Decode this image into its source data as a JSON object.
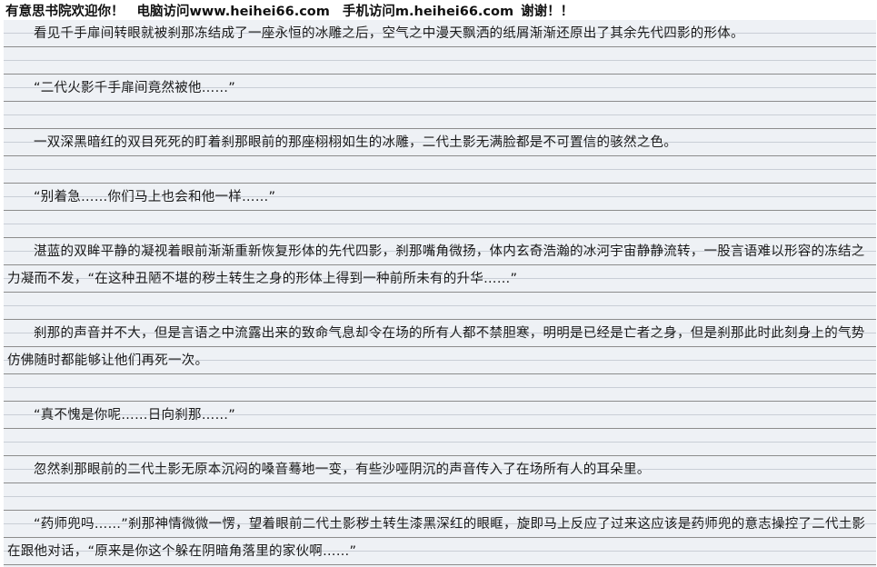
{
  "header": {
    "site_text": "有意思书院欢迎你！",
    "pc_text": "电脑访问www.heihei66.com",
    "mobile_text": "手机访问m.heihei66.com",
    "thanks_text": "谢谢！！"
  },
  "paragraphs": [
    "看见千手扉间转眼就被刹那冻结成了一座永恒的冰雕之后，空气之中漫天飘洒的纸屑渐渐还原出了其余先代四影的形体。",
    "“二代火影千手扉间竟然被他……”",
    "一双深黑暗红的双目死死的盯着刹那眼前的那座栩栩如生的冰雕，二代土影无满脸都是不可置信的骇然之色。",
    "“别着急……你们马上也会和他一样……”",
    "湛蓝的双眸平静的凝视着眼前渐渐重新恢复形体的先代四影，刹那嘴角微扬，体内玄奇浩瀚的冰河宇宙静静流转，一股言语难以形容的冻结之力凝而不发，“在这种丑陋不堪的秽土转生之身的形体上得到一种前所未有的升华……”",
    "刹那的声音并不大，但是言语之中流露出来的致命气息却令在场的所有人都不禁胆寒，明明是已经是亡者之身，但是刹那此时此刻身上的气势仿佛随时都能够让他们再死一次。",
    "“真不愧是你呢……日向刹那……”",
    "忽然刹那眼前的二代土影无原本沉闷的嗓音蓦地一变，有些沙哑阴沉的声音传入了在场所有人的耳朵里。",
    "“药师兜吗……”刹那神情微微一愣，望着眼前二代土影秽土转生漆黑深红的眼眶，旋即马上反应了过来这应该是药师兜的意志操控了二代土影在跟他对话，“原来是你这个躲在阴暗角落里的家伙啊……”"
  ]
}
